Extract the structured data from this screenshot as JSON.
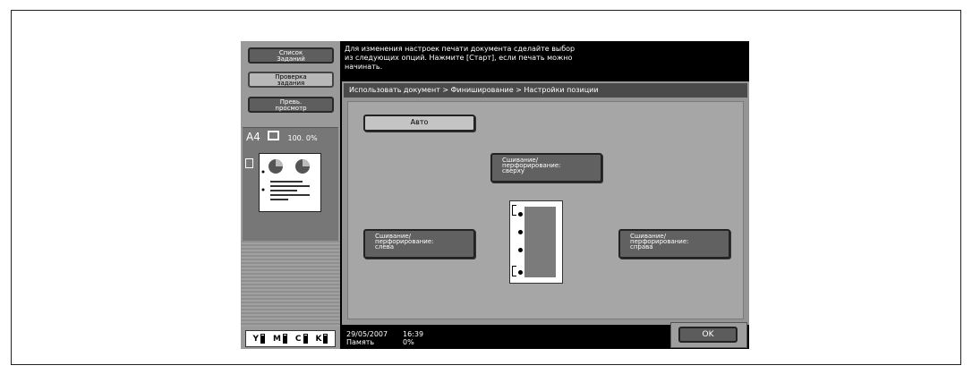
{
  "sidebar": {
    "job_list": [
      "Список",
      "Заданий"
    ],
    "check_job": [
      "Проверка",
      "задания"
    ],
    "preview": [
      "Превь.",
      "просмотр"
    ],
    "paper_size": "A4",
    "zoom": "100. 0%",
    "toner": [
      {
        "color": "Y",
        "level": 0.9
      },
      {
        "color": "M",
        "level": 0.9
      },
      {
        "color": "C",
        "level": 0.9
      },
      {
        "color": "K",
        "level": 0.9
      }
    ]
  },
  "message": {
    "line1": "Для изменения настроек печати документа сделайте выбор",
    "line2": "из следующих опций. Нажмите [Старт], если печать можно",
    "line3": "начинать."
  },
  "breadcrumb": "Использовать документ > Финиширование > Настройки позиции",
  "positions": {
    "auto": "Авто",
    "top": [
      "Сшивание/",
      "перфорирование:",
      "сверху"
    ],
    "left": [
      "Сшивание/",
      "перфорирование:",
      "слева"
    ],
    "right": [
      "Сшивание/",
      "перфорирование:",
      "справа"
    ]
  },
  "status": {
    "date": "29/05/2007",
    "time": "16:39",
    "memory_label": "Память",
    "memory_value": "0%"
  },
  "ok_label": "OK"
}
